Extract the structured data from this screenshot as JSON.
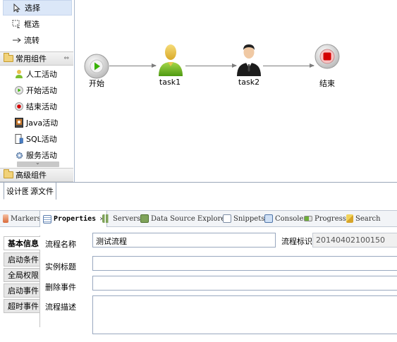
{
  "palette": {
    "tools": [
      {
        "label": "选择",
        "icon": "pointer-icon"
      },
      {
        "label": "框选",
        "icon": "marquee-icon"
      },
      {
        "label": "流转",
        "icon": "arrow-right-icon"
      }
    ],
    "groups": [
      {
        "title": "常用组件",
        "items": [
          {
            "label": "人工活动",
            "icon": "user-icon"
          },
          {
            "label": "开始活动",
            "icon": "start-icon"
          },
          {
            "label": "结束活动",
            "icon": "end-icon"
          },
          {
            "label": "Java活动",
            "icon": "java-icon"
          },
          {
            "label": "SQL活动",
            "icon": "sql-icon"
          },
          {
            "label": "服务活动",
            "icon": "service-gear-icon"
          }
        ]
      },
      {
        "title": "高级组件",
        "items": []
      }
    ]
  },
  "diagram": {
    "nodes": [
      {
        "label": "开始",
        "type": "start"
      },
      {
        "label": "task1",
        "type": "task-green-user"
      },
      {
        "label": "task2",
        "type": "task-black-user"
      },
      {
        "label": "结束",
        "type": "end"
      }
    ],
    "colors": {
      "start": "#38b200",
      "end": "#d40000",
      "edge": "#7d7d7d"
    }
  },
  "editor_tabs": [
    {
      "label": "设计图",
      "active": true
    },
    {
      "label": "源文件",
      "active": false
    }
  ],
  "view_tabs": [
    {
      "label": "Markers",
      "icon": "markers-icon"
    },
    {
      "label": "Properties",
      "icon": "properties-icon",
      "active": true,
      "close": "✕"
    },
    {
      "label": "Servers",
      "icon": "servers-icon"
    },
    {
      "label": "Data Source Explorer",
      "icon": "datasource-icon"
    },
    {
      "label": "Snippets",
      "icon": "snippets-icon"
    },
    {
      "label": "Console",
      "icon": "console-icon"
    },
    {
      "label": "Progress",
      "icon": "progress-icon"
    },
    {
      "label": "Search",
      "icon": "search-icon"
    }
  ],
  "properties": {
    "side_tabs": [
      "基本信息",
      "启动条件",
      "全局权限",
      "启动事件",
      "超时事件"
    ],
    "fields": {
      "name_label": "流程名称",
      "name_value": "测试流程",
      "id_label": "流程标识",
      "id_value": "20140402100150",
      "title_label": "实例标题",
      "title_value": "",
      "delete_label": "删除事件",
      "delete_value": "",
      "desc_label": "流程描述",
      "desc_value": ""
    }
  }
}
